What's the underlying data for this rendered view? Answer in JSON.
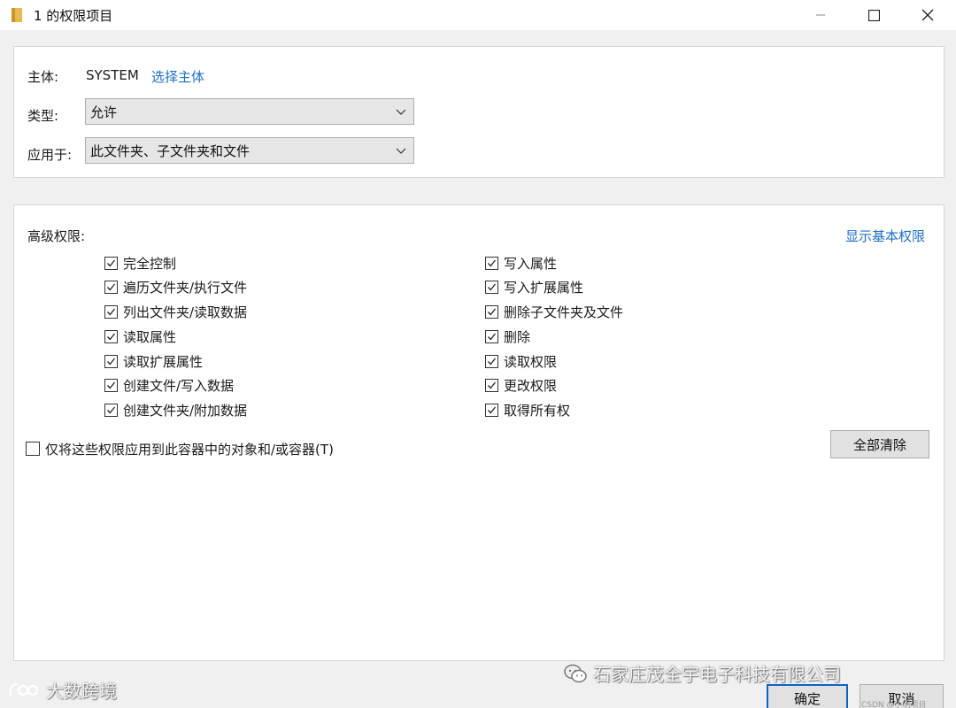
{
  "window": {
    "title": "1 的权限项目",
    "minimize_icon": "minimize-icon",
    "maximize_icon": "maximize-icon",
    "close_icon": "close-icon"
  },
  "principal": {
    "label": "主体:",
    "value": "SYSTEM",
    "select_link": "选择主体"
  },
  "type": {
    "label": "类型:",
    "selected": "允许"
  },
  "applies_to": {
    "label": "应用于:",
    "selected": "此文件夹、子文件夹和文件"
  },
  "advanced": {
    "label": "高级权限:",
    "show_basic_link": "显示基本权限",
    "left_column": [
      {
        "label": "完全控制",
        "checked": true
      },
      {
        "label": "遍历文件夹/执行文件",
        "checked": true
      },
      {
        "label": "列出文件夹/读取数据",
        "checked": true
      },
      {
        "label": "读取属性",
        "checked": true
      },
      {
        "label": "读取扩展属性",
        "checked": true
      },
      {
        "label": "创建文件/写入数据",
        "checked": true
      },
      {
        "label": "创建文件夹/附加数据",
        "checked": true
      }
    ],
    "right_column": [
      {
        "label": "写入属性",
        "checked": true
      },
      {
        "label": "写入扩展属性",
        "checked": true
      },
      {
        "label": "删除子文件夹及文件",
        "checked": true
      },
      {
        "label": "删除",
        "checked": true
      },
      {
        "label": "读取权限",
        "checked": true
      },
      {
        "label": "更改权限",
        "checked": true
      },
      {
        "label": "取得所有权",
        "checked": true
      }
    ],
    "apply_only_container": {
      "label": "仅将这些权限应用到此容器中的对象和/或容器(T)",
      "checked": false
    },
    "clear_all_button": "全部清除"
  },
  "footer": {
    "ok_button": "确定",
    "cancel_button": "取消"
  },
  "watermarks": {
    "left": "大数跨境",
    "right": "石家庄茂全宇电子科技有限公司",
    "small": "CSDN @小明项目"
  },
  "colors": {
    "link": "#1f6fc5",
    "accent_border": "#0a64c4",
    "folder_icon": "#e8b84a"
  }
}
